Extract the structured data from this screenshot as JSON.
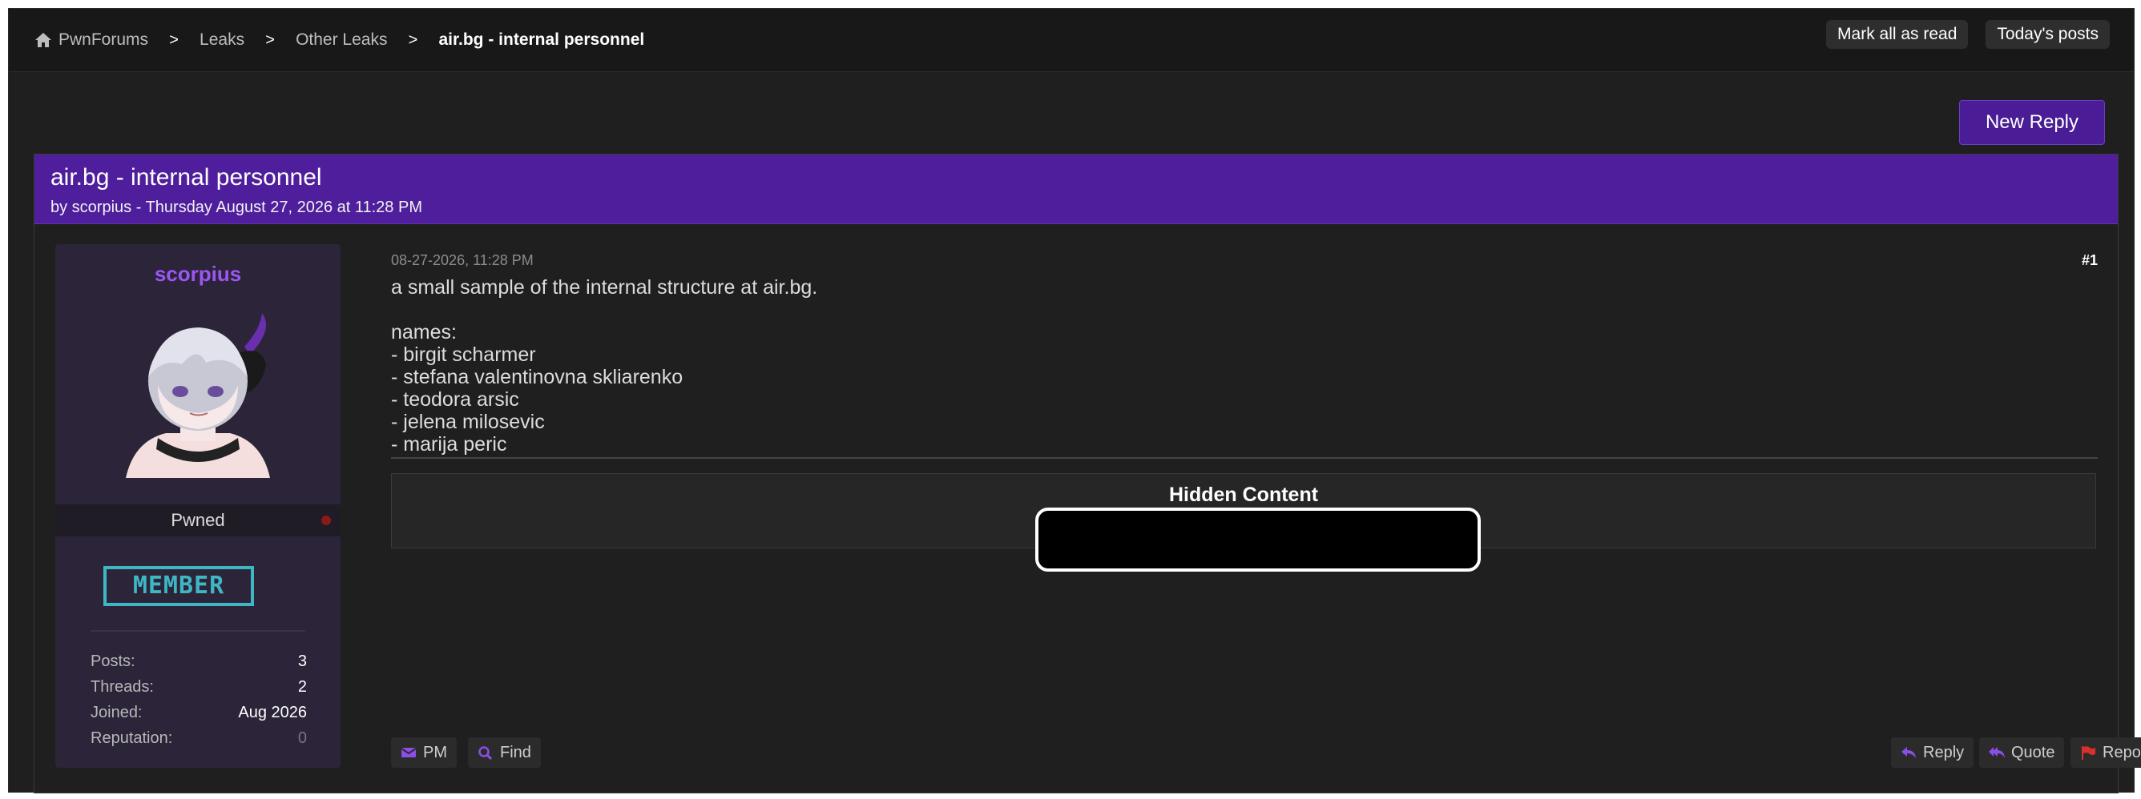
{
  "breadcrumb": {
    "items": [
      "PwnForums",
      "Leaks",
      "Other Leaks",
      "air.bg - internal personnel"
    ],
    "separator": ">"
  },
  "top_actions": {
    "mark_read": "Mark all as read",
    "todays_posts": "Today's posts"
  },
  "new_reply_label": "New Reply",
  "thread": {
    "title": "air.bg - internal personnel",
    "subtitle": "by scorpius - Thursday August 27, 2026 at 11:28 PM"
  },
  "author": {
    "name": "scorpius",
    "status": "Pwned",
    "badge": "MEMBER",
    "stats": [
      {
        "label": "Posts:",
        "value": "3"
      },
      {
        "label": "Threads:",
        "value": "2"
      },
      {
        "label": "Joined:",
        "value": "Aug 2026"
      },
      {
        "label": "Reputation:",
        "value": "0"
      }
    ]
  },
  "post": {
    "date": "08-27-2026, 11:28 PM",
    "number": "#1",
    "lines": [
      "a small sample of the internal structure at air.bg.",
      "",
      "names:",
      "- birgit scharmer",
      "- stefana valentinovna skliarenko",
      "- teodora arsic",
      "- jelena milosevic",
      "- marija peric"
    ],
    "hidden_title": "Hidden Content",
    "actions": {
      "pm": "PM",
      "find": "Find",
      "reply": "Reply",
      "quote": "Quote",
      "report": "Report"
    }
  },
  "colors": {
    "accent": "#4f1e9c",
    "username": "#9b56f4",
    "badge": "#3fb6c4",
    "report_icon": "#d9302c"
  }
}
